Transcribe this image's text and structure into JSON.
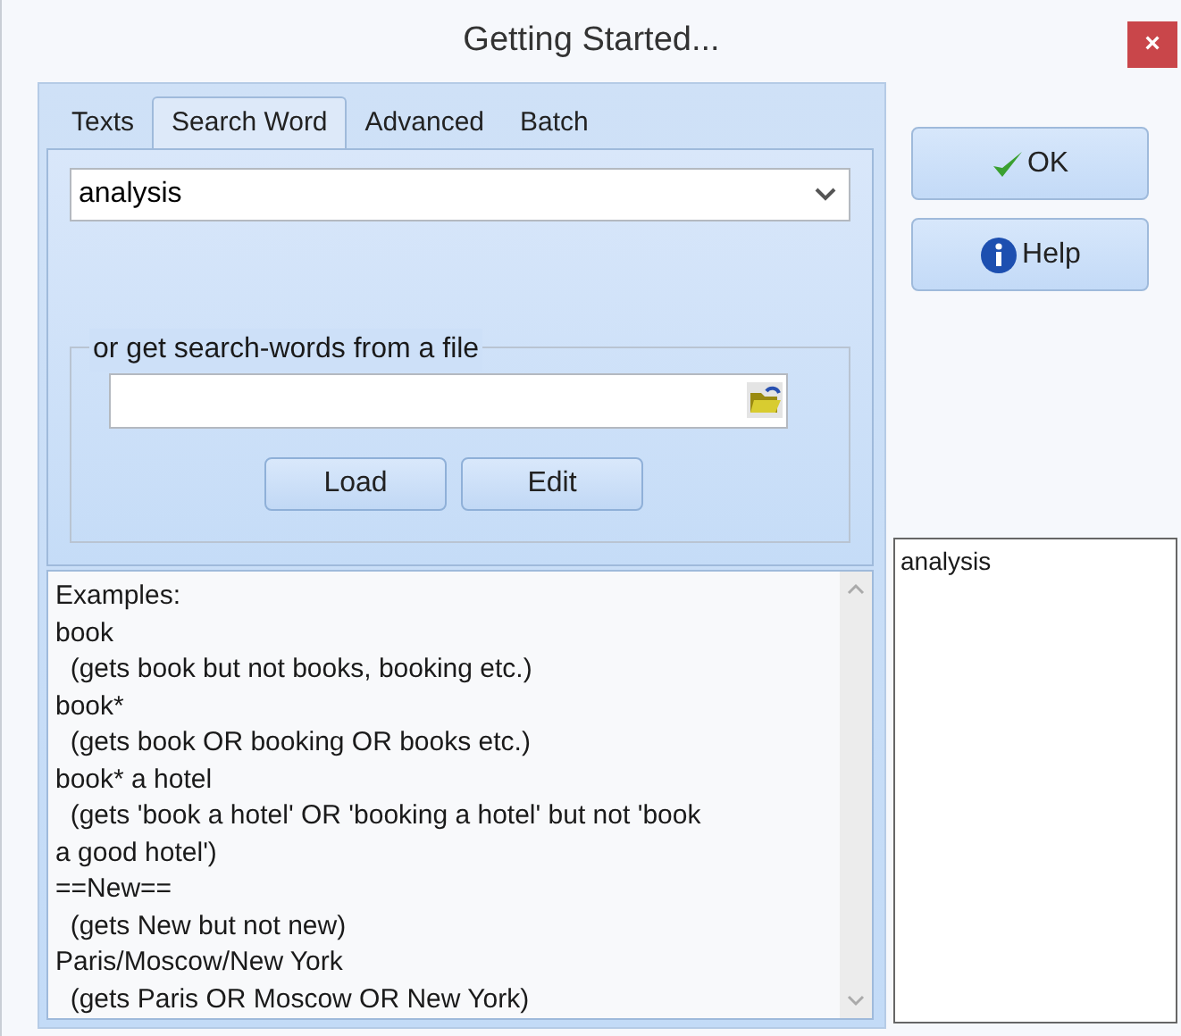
{
  "window": {
    "title": "Getting Started...",
    "close": "×"
  },
  "tabs": [
    {
      "label": "Texts",
      "selected": false
    },
    {
      "label": "Search Word",
      "selected": true
    },
    {
      "label": "Advanced",
      "selected": false
    },
    {
      "label": "Batch",
      "selected": false
    }
  ],
  "search_word": {
    "value": "analysis"
  },
  "file_group": {
    "legend": "or get search-words from a file",
    "buttons": [
      "Load",
      "Edit"
    ]
  },
  "examples": [
    "Examples:",
    "book",
    "  (gets book but not books, booking etc.)",
    "book*",
    "  (gets book OR booking OR books etc.)",
    "book* a hotel",
    "  (gets 'book a hotel' OR 'booking a hotel' but not 'book",
    "a good hotel')",
    "==New==",
    "  (gets New but not new)",
    "Paris/Moscow/New York",
    "  (gets Paris OR Moscow OR New York)"
  ],
  "side_buttons": [
    {
      "kind": "ok",
      "label": "OK"
    },
    {
      "kind": "help",
      "label": "Help"
    }
  ],
  "word_list": [
    "analysis"
  ]
}
